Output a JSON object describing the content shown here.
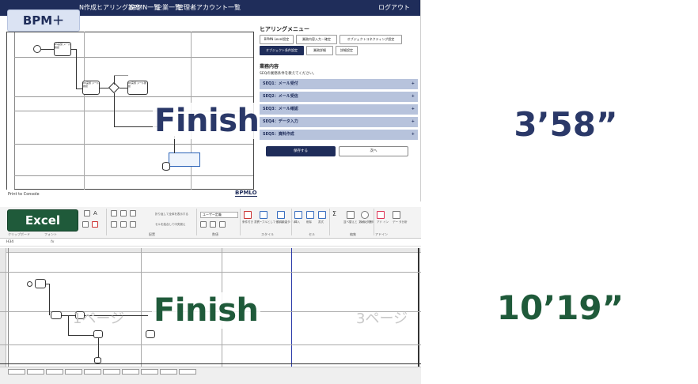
{
  "top_app": {
    "badge": "BPM＋",
    "nav": {
      "item1": "N作成ヒアリング設定",
      "item2": "BPMN一覧",
      "item3": "企業一覧",
      "item4": "管理者アカウント一覧",
      "logout": "ログアウト"
    },
    "diagram_labels": {
      "task1": "RS実施\nメール確認",
      "task2": "RS実施\nメール確認",
      "task3": "RS実施\nメール確認"
    },
    "print_to_console": "Print to Console",
    "logo": "BPMLO",
    "hearing": {
      "title": "ヒアリングメニュー",
      "buttons": [
        "BPMN Level設定",
        "業務内容入力・確定",
        "オブジェクトコネクティング設定",
        "オブジェクト条件設定",
        "業務詳細",
        "詳細設定"
      ],
      "work_title": "業務内容",
      "work_desc": "SEQの業務条件を教えてください。",
      "seqs": [
        "SEQ1：メール受付",
        "SEQ2：メール受信",
        "SEQ3：メール確認",
        "SEQ4：データ入力",
        "SEQ5：資料作成"
      ],
      "plus": "+",
      "save": "保存する",
      "next": "次へ"
    },
    "finish": "Finish",
    "time": "3’58”"
  },
  "bottom_app": {
    "badge": "Excel",
    "number_format": "ユーザー定義",
    "ribbon_labels": {
      "wrap": "折り返して全体を表示する",
      "merge": "セルを結合して中央揃え",
      "conditional": "条件付き\n書式",
      "table": "テーブルとして\n書式設定",
      "cellstyle": "セルの\nスタイル",
      "insert": "挿入",
      "delete": "削除",
      "format": "書式",
      "sort": "並べ替えと\nフィルター",
      "find": "検索と\n選択",
      "addin": "アド\nイン",
      "data": "デー\nタ分析"
    },
    "group_labels": {
      "clipboard": "クリップボード",
      "font": "フォント",
      "align": "配置",
      "number": "数値",
      "style": "スタイル",
      "cell": "セル",
      "edit": "編集",
      "addin": "アドイン"
    },
    "cell_ref": "H34",
    "fx": "fx",
    "page1": "1ページ",
    "page3": "3ページ",
    "finish": "Finish",
    "time": "10’19”"
  },
  "colors": {
    "bpm_navy": "#2a3868",
    "excel_green": "#1f5a3a",
    "nav_bg": "#1f2d5a",
    "seq_row": "#b7c3dc"
  }
}
